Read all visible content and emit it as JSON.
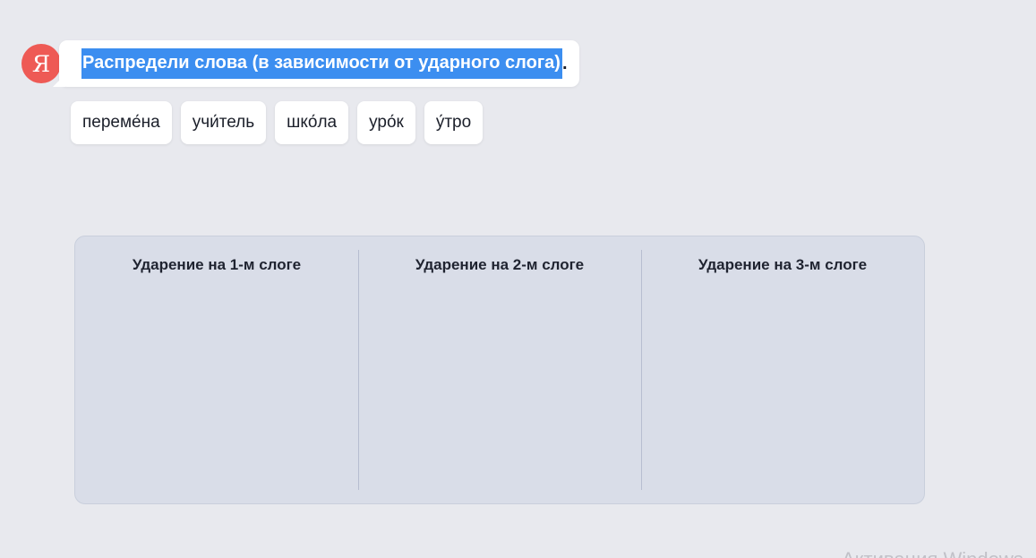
{
  "assistant": {
    "avatar_letter": "Я"
  },
  "task": {
    "instruction": "Распредели слова (в зависимости от ударного слога)",
    "instruction_end": "."
  },
  "words": [
    "переме́на",
    "учи́тель",
    "шко́ла",
    "уро́к",
    "у́тро"
  ],
  "board": {
    "columns": [
      "Ударение на 1-м слоге",
      "Ударение на 2-м слоге",
      "Ударение на 3-м слоге"
    ]
  },
  "watermark": "Активация Windows",
  "colors": {
    "background": "#e8e9ee",
    "avatar": "#ee5a55",
    "selection": "#3c8ef0",
    "board": "#d9dde8"
  }
}
